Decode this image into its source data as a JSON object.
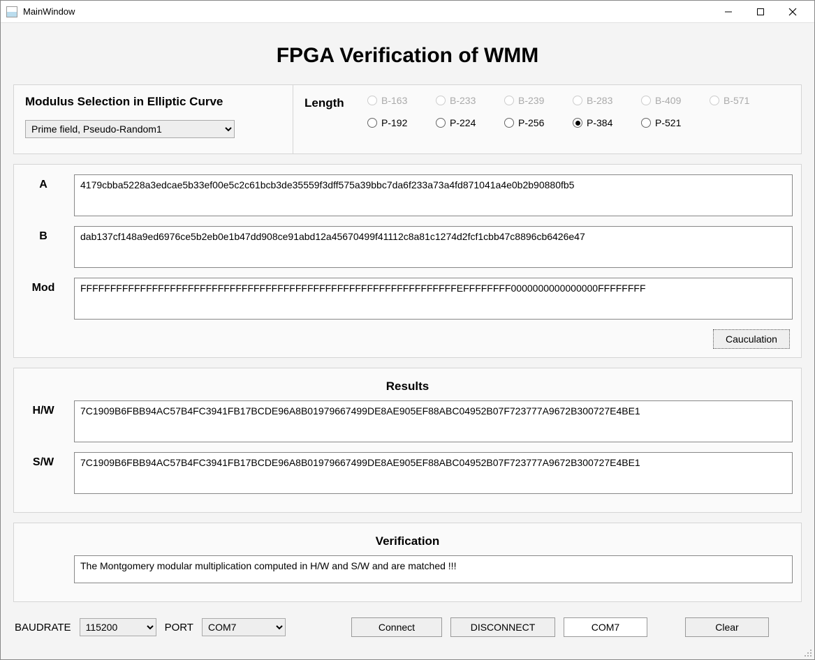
{
  "window": {
    "title": "MainWindow"
  },
  "heading": "FPGA Verification of WMM",
  "modulus": {
    "label": "Modulus Selection in Elliptic Curve",
    "selected": "Prime field, Pseudo-Random1"
  },
  "length": {
    "label": "Length",
    "row1": [
      {
        "label": "B-163",
        "enabled": false,
        "selected": false
      },
      {
        "label": "B-233",
        "enabled": false,
        "selected": false
      },
      {
        "label": "B-239",
        "enabled": false,
        "selected": false
      },
      {
        "label": "B-283",
        "enabled": false,
        "selected": false
      },
      {
        "label": "B-409",
        "enabled": false,
        "selected": false
      },
      {
        "label": "B-571",
        "enabled": false,
        "selected": false
      }
    ],
    "row2": [
      {
        "label": "P-192",
        "enabled": true,
        "selected": false
      },
      {
        "label": "P-224",
        "enabled": true,
        "selected": false
      },
      {
        "label": "P-256",
        "enabled": true,
        "selected": false
      },
      {
        "label": "P-384",
        "enabled": true,
        "selected": true
      },
      {
        "label": "P-521",
        "enabled": true,
        "selected": false
      }
    ]
  },
  "inputs": {
    "A_label": "A",
    "A": "4179cbba5228a3edcae5b33ef00e5c2c61bcb3de35559f3dff575a39bbc7da6f233a73a4fd871041a4e0b2b90880fb5",
    "B_label": "B",
    "B": "dab137cf148a9ed6976ce5b2eb0e1b47dd908ce91abd12a45670499f41112c8a81c1274d2fcf1cbb47c8896cb6426e47",
    "Mod_label": "Mod",
    "Mod": "FFFFFFFFFFFFFFFFFFFFFFFFFFFFFFFFFFFFFFFFFFFFFFFFFFFFFFFFFFFFFFFEFFFFFFFF0000000000000000FFFFFFFF"
  },
  "calc_button": "Cauculation",
  "results": {
    "title": "Results",
    "hw_label": "H/W",
    "HW": "7C1909B6FBB94AC57B4FC3941FB17BCDE96A8B01979667499DE8AE905EF88ABC04952B07F723777A9672B300727E4BE1",
    "sw_label": "S/W",
    "SW": "7C1909B6FBB94AC57B4FC3941FB17BCDE96A8B01979667499DE8AE905EF88ABC04952B07F723777A9672B300727E4BE1"
  },
  "verification": {
    "title": "Verification",
    "message": "The Montgomery modular multiplication computed in H/W and S/W and are matched !!!"
  },
  "bottom": {
    "baudrate_label": "BAUDRATE",
    "baudrate": "115200",
    "port_label": "PORT",
    "port": "COM7",
    "connect": "Connect",
    "disconnect": "DISCONNECT",
    "status": "COM7",
    "clear": "Clear"
  }
}
